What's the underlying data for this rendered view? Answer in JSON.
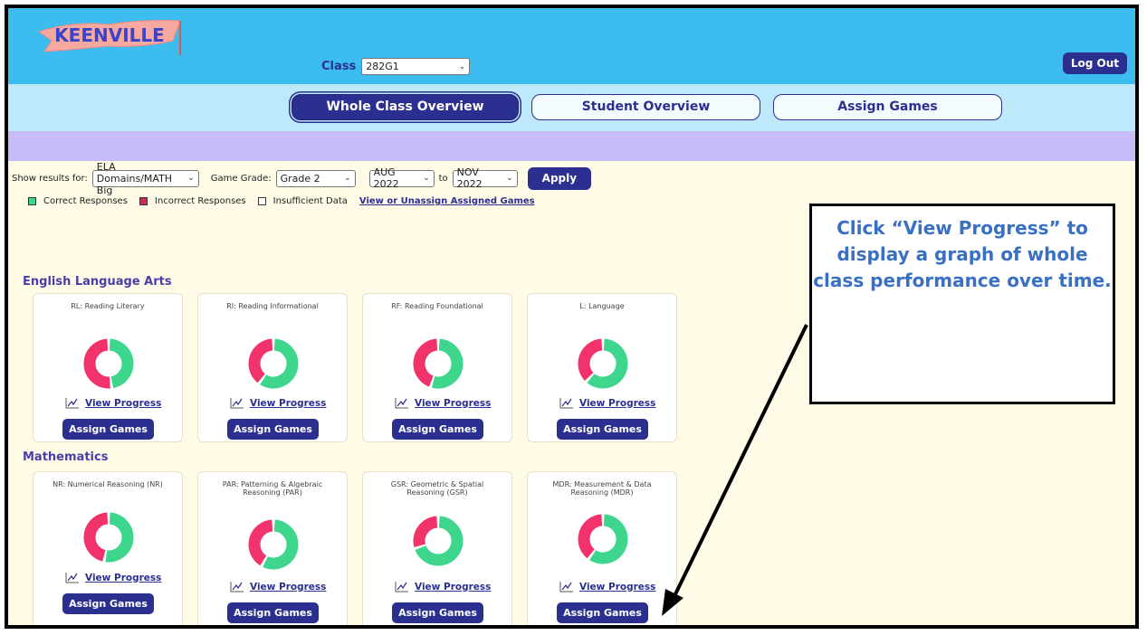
{
  "app": {
    "logo_text": "KEENVILLE",
    "class_label": "Class",
    "class_value": "282G1",
    "logout_label": "Log Out"
  },
  "nav": {
    "tabs": [
      {
        "label": "Whole Class Overview",
        "active": true
      },
      {
        "label": "Student Overview",
        "active": false
      },
      {
        "label": "Assign Games",
        "active": false
      }
    ]
  },
  "filters": {
    "show_label": "Show results for:",
    "show_value": "ELA Domains/MATH Big",
    "grade_label": "Game Grade:",
    "grade_value": "Grade 2",
    "from_value": "AUG 2022",
    "to_label": "to",
    "to_value": "NOV 2022",
    "apply_label": "Apply"
  },
  "legend": {
    "correct": "Correct Responses",
    "incorrect": "Incorrect Responses",
    "insufficient": "Insufficient Data",
    "link": "View or Unassign Assigned Games",
    "colors": {
      "correct": "#3dd68c",
      "incorrect": "#f2336b"
    }
  },
  "sections": {
    "ela_title": "English Language Arts",
    "math_title": "Mathematics"
  },
  "ela_cards": [
    {
      "title": "RL: Reading Literary",
      "correct_fraction": 0.48
    },
    {
      "title": "RI: Reading Informational",
      "correct_fraction": 0.6
    },
    {
      "title": "RF: Reading Foundational",
      "correct_fraction": 0.55
    },
    {
      "title": "L: Language",
      "correct_fraction": 0.62
    }
  ],
  "math_cards": [
    {
      "title": "NR: Numerical Reasoning (NR)",
      "correct_fraction": 0.53
    },
    {
      "title": "PAR: Patterning & Algebraic Reasoning (PAR)",
      "correct_fraction": 0.58
    },
    {
      "title": "GSR: Geometric & Spatial Reasoning (GSR)",
      "correct_fraction": 0.7
    },
    {
      "title": "MDR: Measurement & Data Reasoning (MDR)",
      "correct_fraction": 0.6
    }
  ],
  "card_labels": {
    "view_progress": "View Progress",
    "assign_games": "Assign Games"
  },
  "callout": {
    "text": "Click “View Progress” to display a graph of whole class performance over time."
  }
}
